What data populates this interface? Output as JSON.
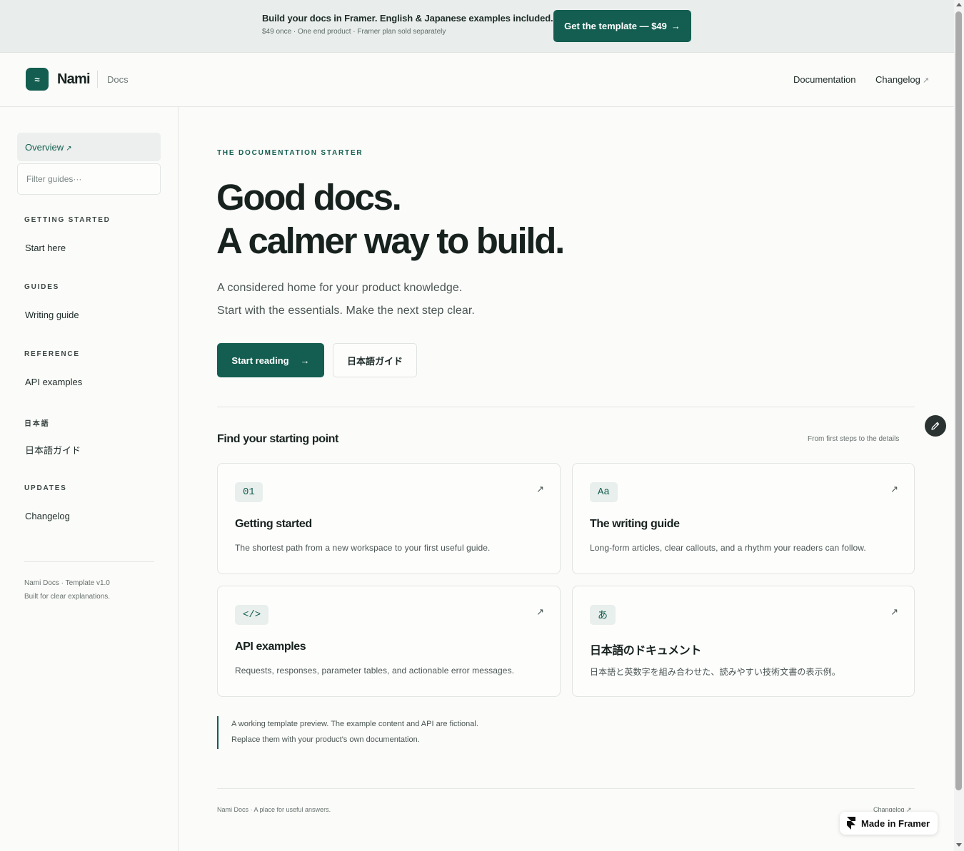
{
  "promo": {
    "title": "Build your docs in Framer. English & Japanese examples included.",
    "subtitle": "$49 once · One end product · Framer plan sold separately",
    "cta": "Get the template — $49",
    "cta_arrow": "→"
  },
  "header": {
    "logo_glyph": "≈",
    "brand": "Nami",
    "section": "Docs",
    "nav": {
      "documentation": "Documentation",
      "changelog": "Changelog",
      "changelog_arrow": "↗"
    }
  },
  "sidebar": {
    "overview": "Overview",
    "overview_arrow": "↗",
    "filter_placeholder": "Filter guides···",
    "sections": [
      {
        "title": "GETTING STARTED",
        "link": "Start here"
      },
      {
        "title": "GUIDES",
        "link": "Writing guide"
      },
      {
        "title": "REFERENCE",
        "link": "API examples"
      },
      {
        "title": "日本語",
        "link": "日本語ガイド"
      },
      {
        "title": "UPDATES",
        "link": "Changelog"
      }
    ],
    "footer": {
      "line1": "Nami Docs · Template v1.0",
      "line2": "Built for clear explanations."
    }
  },
  "main": {
    "kicker": "THE DOCUMENTATION STARTER",
    "hero_line1": "Good docs.",
    "hero_line2": "A calmer way to build.",
    "lede_line1": "A considered home for your product knowledge.",
    "lede_line2": "Start with the essentials. Make the next step clear.",
    "primary_button": "Start reading",
    "primary_arrow": "→",
    "secondary_button": "日本語ガイド",
    "find_title": "Find your starting point",
    "find_note": "From first steps to the details",
    "cards": [
      {
        "chip": "01",
        "arrow": "↗",
        "title": "Getting started",
        "desc": "The shortest path from a new workspace to your first useful guide."
      },
      {
        "chip": "Aa",
        "arrow": "↗",
        "title": "The writing guide",
        "desc": "Long-form articles, clear callouts, and a rhythm your readers can follow."
      },
      {
        "chip": "</>",
        "arrow": "↗",
        "title": "API examples",
        "desc": "Requests, responses, parameter tables, and actionable error messages."
      },
      {
        "chip": "あ",
        "arrow": "↗",
        "title": "日本語のドキュメント",
        "desc": "日本語と英数字を組み合わせた、読みやすい技術文書の表示例。"
      }
    ],
    "note_line1": "A working template preview. The example content and API are fictional.",
    "note_line2": "Replace them with your product's own documentation.",
    "footer_left": "Nami Docs · A place for useful answers.",
    "footer_right": "Changelog ↗"
  },
  "floating": {
    "edit_icon": "pencil-icon",
    "framer_badge": "Made in Framer"
  },
  "colors": {
    "accent": "#135e50",
    "background": "#fbfbf9",
    "banner": "#e9eeec",
    "text": "#17221f"
  }
}
